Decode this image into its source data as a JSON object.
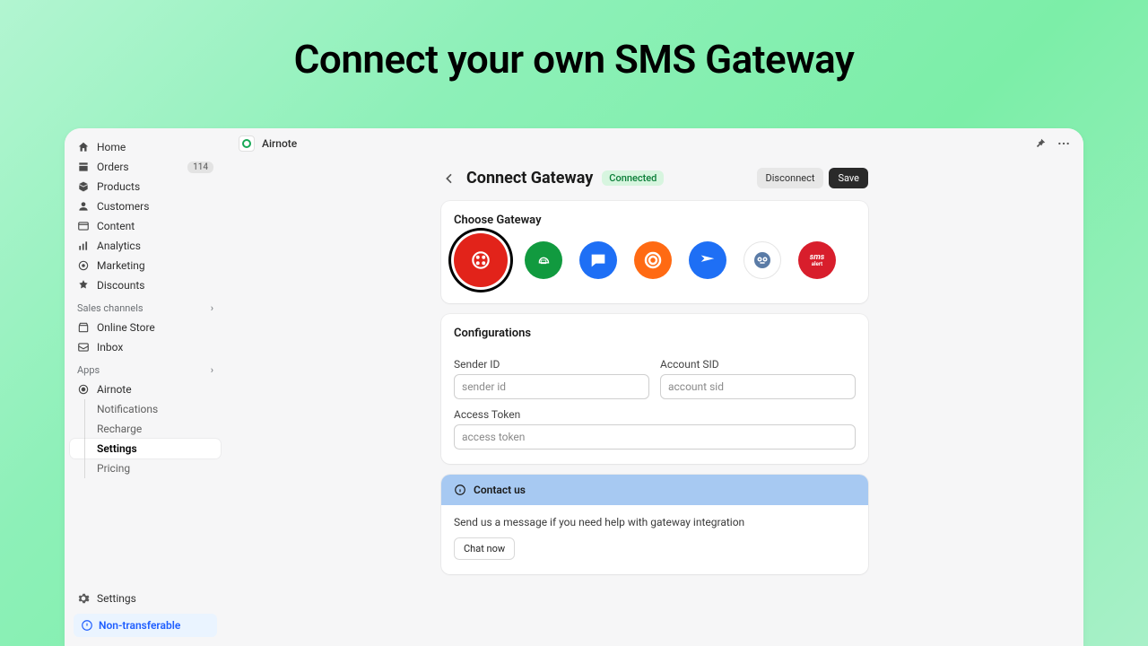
{
  "hero": {
    "title": "Connect your own SMS Gateway"
  },
  "topbar": {
    "app_name": "Airnote"
  },
  "sidebar": {
    "items": [
      {
        "label": "Home"
      },
      {
        "label": "Orders",
        "badge": "114"
      },
      {
        "label": "Products"
      },
      {
        "label": "Customers"
      },
      {
        "label": "Content"
      },
      {
        "label": "Analytics"
      },
      {
        "label": "Marketing"
      },
      {
        "label": "Discounts"
      }
    ],
    "sales_header": "Sales channels",
    "sales": [
      {
        "label": "Online Store"
      },
      {
        "label": "Inbox"
      }
    ],
    "apps_header": "Apps",
    "apps_parent": "Airnote",
    "apps_sub": [
      {
        "label": "Notifications"
      },
      {
        "label": "Recharge"
      },
      {
        "label": "Settings"
      },
      {
        "label": "Pricing"
      }
    ],
    "settings_label": "Settings",
    "non_transferable": "Non-transferable"
  },
  "page": {
    "title": "Connect Gateway",
    "status": "Connected",
    "disconnect_label": "Disconnect",
    "save_label": "Save",
    "gateway_card_title": "Choose Gateway",
    "gateway_smsalert": "sms alert",
    "config_card_title": "Configurations",
    "fields": {
      "sender_id_label": "Sender ID",
      "sender_id_placeholder": "sender id",
      "account_sid_label": "Account SID",
      "account_sid_placeholder": "account sid",
      "access_token_label": "Access Token",
      "access_token_placeholder": "access token"
    },
    "contact": {
      "banner": "Contact us",
      "body": "Send us a message if you need help with gateway integration",
      "chat_label": "Chat now"
    }
  }
}
